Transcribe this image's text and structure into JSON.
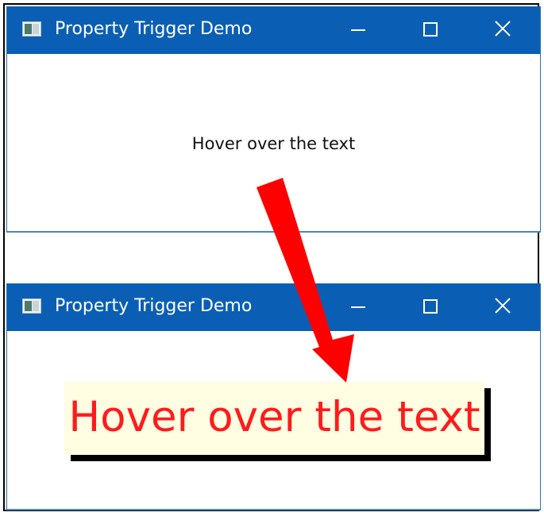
{
  "windows": [
    {
      "title": "Property Trigger Demo",
      "body_text": "Hover over the text"
    },
    {
      "title": "Property Trigger Demo",
      "hover_text": "Hover over the text"
    }
  ],
  "colors": {
    "titlebar": "#0a5fb4",
    "hover_text": "#ff1b1b",
    "hover_background": "#fffde2",
    "arrow": "#ff0000"
  },
  "icons": [
    "app-icon",
    "minimize-icon",
    "maximize-icon",
    "close-icon",
    "red-arrow"
  ]
}
